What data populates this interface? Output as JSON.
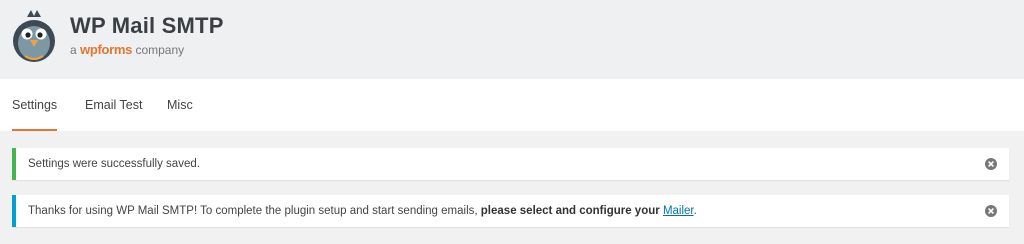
{
  "brand": {
    "title": "WP Mail SMTP",
    "sub_prefix": "a",
    "sub_brand": "wpforms",
    "sub_suffix": "company"
  },
  "tabs": [
    {
      "label": "Settings",
      "active": true
    },
    {
      "label": "Email Test",
      "active": false
    },
    {
      "label": "Misc",
      "active": false
    }
  ],
  "notices": {
    "success": {
      "text": "Settings were successfully saved.",
      "color": "#46b450"
    },
    "info": {
      "text_before": "Thanks for using WP Mail SMTP! To complete the plugin setup and start sending emails, ",
      "bold_text": "please select and configure your",
      "link_text": "Mailer",
      "text_after": ".",
      "color": "#00a0d2"
    }
  },
  "icons": {
    "logo": "pigeon-mascot-icon",
    "dismiss": "close-circle-icon"
  },
  "colors": {
    "accent": "#e27730",
    "link": "#0073aa"
  }
}
